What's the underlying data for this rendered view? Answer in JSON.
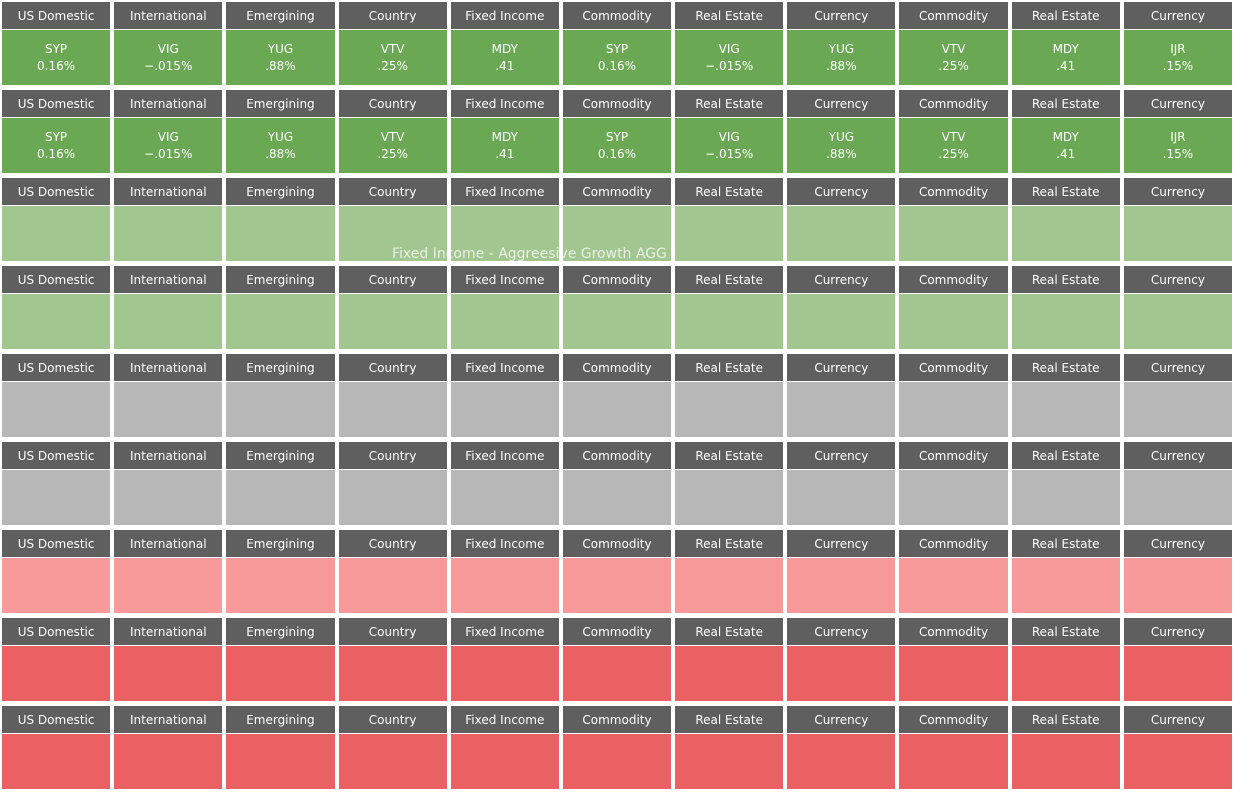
{
  "categories": [
    "US Domestic",
    "International",
    "Emergining",
    "Country",
    "Fixed Income",
    "Commodity",
    "Real Estate",
    "Currency",
    "Commodity",
    "Real Estate",
    "Currency"
  ],
  "tickers": [
    {
      "symbol": "SYP",
      "change": "0.16%"
    },
    {
      "symbol": "VIG",
      "change": "−.015%"
    },
    {
      "symbol": "YUG",
      "change": ".88%"
    },
    {
      "symbol": "VTV",
      "change": ".25%"
    },
    {
      "symbol": "MDY",
      "change": ".41"
    },
    {
      "symbol": "SYP",
      "change": "0.16%"
    },
    {
      "symbol": "VIG",
      "change": "−.015%"
    },
    {
      "symbol": "YUG",
      "change": ".88%"
    },
    {
      "symbol": "VTV",
      "change": ".25%"
    },
    {
      "symbol": "MDY",
      "change": ".41"
    },
    {
      "symbol": "IJR",
      "change": ".15%"
    }
  ],
  "rows": [
    {
      "color": "#6aa854",
      "show_tickers": true
    },
    {
      "color": "#6aa854",
      "show_tickers": true
    },
    {
      "color": "#a2c690",
      "show_tickers": false,
      "overlay": "Fixed Income - Aggreesive Growth AGG"
    },
    {
      "color": "#a2c690",
      "show_tickers": false
    },
    {
      "color": "#b7b7b7",
      "show_tickers": false
    },
    {
      "color": "#b7b7b7",
      "show_tickers": false
    },
    {
      "color": "#f99a9a",
      "show_tickers": false
    },
    {
      "color": "#ea6063",
      "show_tickers": false
    },
    {
      "color": "#ea6063",
      "show_tickers": false
    }
  ],
  "colors": {
    "header": "#5f5f5f"
  }
}
